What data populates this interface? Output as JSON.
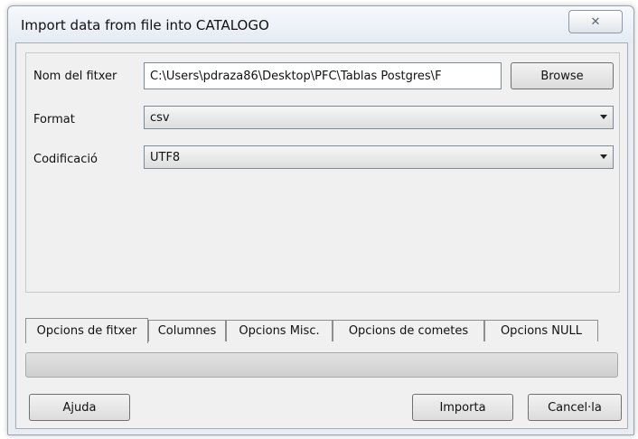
{
  "window": {
    "title": "Import data from file into CATALOGO",
    "close_glyph": "✕"
  },
  "form": {
    "filename_label": "Nom del fitxer",
    "filename_value": "C:\\Users\\pdraza86\\Desktop\\PFC\\Tablas Postgres\\F",
    "browse_label": "Browse",
    "format_label": "Format",
    "format_value": "csv",
    "encoding_label": "Codificació",
    "encoding_value": "UTF8"
  },
  "tabs": [
    {
      "label": "Opcions de fitxer",
      "active": true
    },
    {
      "label": "Columnes",
      "active": false
    },
    {
      "label": "Opcions Misc.",
      "active": false
    },
    {
      "label": "Opcions de cometes",
      "active": false
    },
    {
      "label": "Opcions NULL",
      "active": false
    }
  ],
  "footer": {
    "help_label": "Ajuda",
    "import_label": "Importa",
    "cancel_label": "Cancel·la"
  }
}
